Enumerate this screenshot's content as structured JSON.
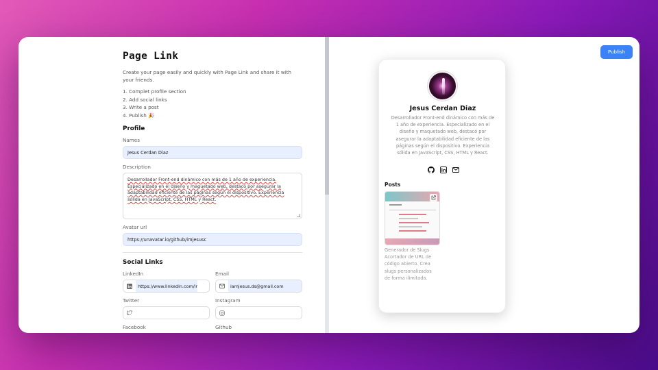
{
  "editor": {
    "title": "Page Link",
    "intro": "Create your page easily and quickly with Page Link and share it with your friends.",
    "steps": [
      "1. Complet profile section",
      "2. Add social links",
      "3. Write a post",
      "4. Publish 🎉"
    ],
    "profile": {
      "section_title": "Profile",
      "names_label": "Names",
      "names_value": "Jesus Cerdan Diaz",
      "description_label": "Description",
      "description_value": "Desarrollador Front-end dinámico con más de 1 año de experiencia. Especializado en el diseño y maquetado web, destacó por asegurar la adaptabilidad eficiente de las páginas según el dispositivo. Experiencia sólida en JavaScript, CSS, HTML y React.",
      "avatar_label": "Avatar url",
      "avatar_value": "https://unavatar.io/github/imjesusc"
    },
    "social": {
      "section_title": "Social Links",
      "linkedin_label": "LinkedIn",
      "linkedin_value": "https://www.linkedin.com/in.",
      "email_label": "Email",
      "email_value": "iamjesus.ds@gmail.com",
      "twitter_label": "Twitter",
      "twitter_value": "",
      "instagram_label": "Instagram",
      "instagram_value": "",
      "facebook_label": "Facebook",
      "github_label": "Github"
    }
  },
  "preview": {
    "publish_label": "Publish",
    "name": "Jesus Cerdan Diaz",
    "bio": "Desarrollador Front-end dinámico con más de 1 año de experiencia. Especializado en el diseño y maquetado web, destacó por asegurar la adaptabilidad eficiente de las páginas según el dispositivo. Experiencia sólida en JavaScript, CSS, HTML y React.",
    "social_icons": [
      "github-icon",
      "linkedin-icon",
      "mail-icon"
    ],
    "posts_title": "Posts",
    "post_description": "Generador de Slugs Acortador de URL de código abierto. Crea slugs personalizados de forma ilimitada."
  },
  "colors": {
    "accent": "#3b82f6",
    "input_fill": "#e8efff"
  }
}
